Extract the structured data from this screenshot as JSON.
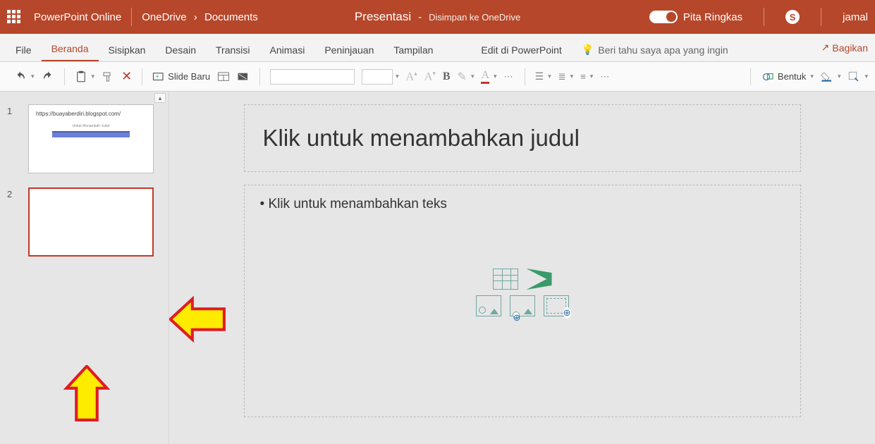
{
  "titlebar": {
    "app_name": "PowerPoint Online",
    "crumb_root": "OneDrive",
    "crumb_folder": "Documents",
    "doc_name": "Presentasi",
    "saved_text": "Disimpan ke OneDrive",
    "ribbon_toggle_label": "Pita Ringkas",
    "user_name": "jamal"
  },
  "tabs": {
    "file": "File",
    "home": "Beranda",
    "insert": "Sisipkan",
    "design": "Desain",
    "transitions": "Transisi",
    "animations": "Animasi",
    "review": "Peninjauan",
    "view": "Tampilan",
    "edit_in_pp": "Edit di PowerPoint",
    "tell_me": "Beri tahu saya apa yang ingin",
    "share": "Bagikan"
  },
  "ribbon": {
    "new_slide": "Slide Baru",
    "shape": "Bentuk"
  },
  "slides": [
    {
      "num": "1",
      "title_text": "https://buayaberdiri.blogspot.com/",
      "subtitle_text": "Untuk Menambah Judul"
    },
    {
      "num": "2"
    }
  ],
  "canvas": {
    "title_placeholder": "Klik untuk menambahkan judul",
    "body_placeholder": "Klik untuk menambahkan teks"
  },
  "icons": {
    "waffle": "app-launcher-icon",
    "skype": "S",
    "undo": "undo-icon",
    "redo": "redo-icon",
    "clipboard": "clipboard-icon",
    "paint": "format-painter-icon",
    "delete": "delete-icon",
    "layout": "layout-icon",
    "reset": "reset-icon",
    "bulb": "lightbulb-icon",
    "share_arrow": "share-icon"
  },
  "colors": {
    "brand": "#b7472a",
    "selected": "#c0392b",
    "arrow_fill": "#fdeb00",
    "arrow_stroke": "#e01b24"
  }
}
